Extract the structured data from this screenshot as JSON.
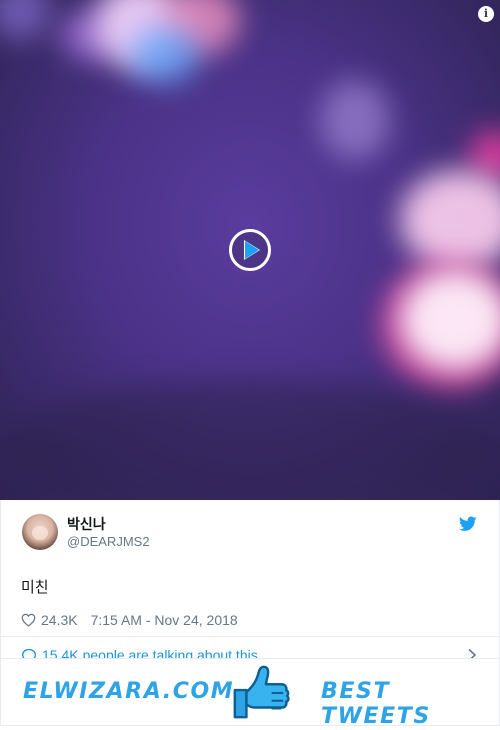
{
  "tweet": {
    "author_name": "박신나",
    "author_handle": "@DEARJMS2",
    "text": "미친",
    "likes": "24.3K",
    "timestamp": "7:15 AM - Nov 24, 2018",
    "talking_count": "15.4K",
    "talking_label": "people are talking about this"
  },
  "media": {
    "info_glyph": "i",
    "play_icon": "play-icon"
  },
  "banner": {
    "site_name": "ELWIZARA.COM",
    "tagline": "BEST TWEETS"
  },
  "colors": {
    "twitter_blue": "#1da1f2",
    "link_blue": "#1b95e0",
    "banner_blue": "#2ea3e6",
    "text_dark": "#14171a",
    "text_gray": "#657786"
  }
}
